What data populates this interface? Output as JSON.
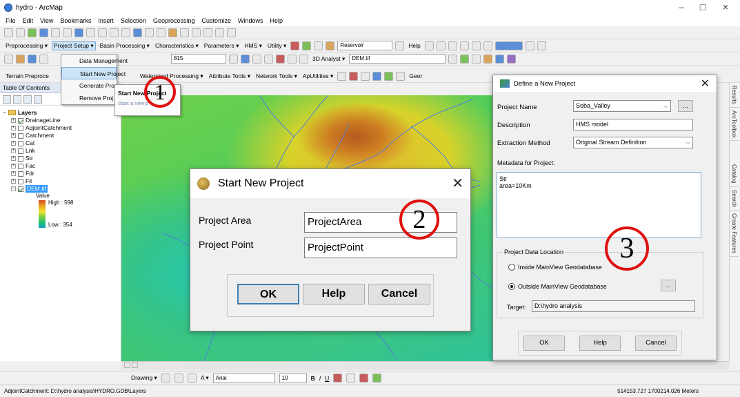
{
  "window": {
    "title": "hydro - ArcMap",
    "minimize": "–",
    "maximize": "□",
    "close": "×"
  },
  "menubar": [
    "File",
    "Edit",
    "View",
    "Bookmarks",
    "Insert",
    "Selection",
    "Geoprocessing",
    "Customize",
    "Windows",
    "Help"
  ],
  "toolbar_archydro": {
    "menus": [
      "Preprocessing ▾",
      "Project Setup ▾",
      "Basin Processing ▾",
      "Characteristics ▾",
      "Parameters ▾",
      "HMS ▾",
      "Utility ▾"
    ],
    "reservoir_select": "Reservoir",
    "help_label": "Help"
  },
  "toolbar_standard": {
    "scale_value": "815",
    "analyst_label": "3D Analyst ▾",
    "layer_select": "DEM.tif"
  },
  "toolbar_terrain": {
    "menus": [
      "Terrain Preproce",
      "Watershed Processing ▾",
      "Attribute Tools ▾",
      "Network Tools ▾",
      "ApUtilities ▾"
    ],
    "geo_label": "Geor"
  },
  "project_setup_menu": {
    "items": [
      "Data Management",
      "Start New Project",
      "Generate Pro",
      "Remove Proj"
    ],
    "submenu_title": "Start New Project",
    "submenu_hint": "Start a new p"
  },
  "toc": {
    "title": "Table Of Contents",
    "root": "Layers",
    "layers": [
      {
        "name": "DrainageLine",
        "checked": true
      },
      {
        "name": "AdjointCatchment",
        "checked": false
      },
      {
        "name": "Catchment",
        "checked": false
      },
      {
        "name": "Cat",
        "checked": false
      },
      {
        "name": "Lnk",
        "checked": false
      },
      {
        "name": "Str",
        "checked": false
      },
      {
        "name": "Fac",
        "checked": false
      },
      {
        "name": "Fdr",
        "checked": false
      },
      {
        "name": "Fil",
        "checked": false
      },
      {
        "name": "DEM.tif",
        "checked": true,
        "selected": true
      }
    ],
    "legend": {
      "title": "Value",
      "high": "High : 598",
      "low": "Low : 354"
    }
  },
  "start_dialog": {
    "title": "Start New Project",
    "project_area_label": "Project Area",
    "project_area_value": "ProjectArea",
    "project_point_label": "Project Point",
    "project_point_value": "ProjectPoint",
    "ok": "OK",
    "help": "Help",
    "cancel": "Cancel"
  },
  "define_dialog": {
    "title": "Define a New Project",
    "project_name_label": "Project Name",
    "project_name_value": "Soba_Valley",
    "browse": "...",
    "description_label": "Description",
    "description_value": "HMS model",
    "extraction_label": "Extraction Method",
    "extraction_value": "Original Stream Definition",
    "metadata_label": "Metadata for Project:",
    "metadata_line1": "Str",
    "metadata_line2": "area=10Km",
    "location_group": "Project Data Location",
    "inside_option": "Inside MainView Geodatabase",
    "outside_option": "Outside MainView Geodatabase",
    "target_label": "Target:",
    "target_value": "D:\\hydro analysis",
    "ok": "OK",
    "help": "Help",
    "cancel": "Cancel"
  },
  "right_tabs": [
    "Results",
    "ArcToolbox",
    "Catalog",
    "Search",
    "Create Features"
  ],
  "draw_toolbar": {
    "drawing": "Drawing ▾",
    "font": "Arial",
    "size": "10",
    "bold": "B",
    "italic": "I",
    "underline": "U",
    "text_tool": "A ▾"
  },
  "status": {
    "left": "AdjointCatchment: D:\\hydro analysis\\HYDRO.GDB\\Layers",
    "coords": "514153.727 1700214.026 Meters"
  },
  "annotations": [
    "1",
    "2",
    "3"
  ],
  "colors": {
    "annotation": "#e01010",
    "selection": "#3399ff",
    "highlight": "#cce4f7"
  }
}
